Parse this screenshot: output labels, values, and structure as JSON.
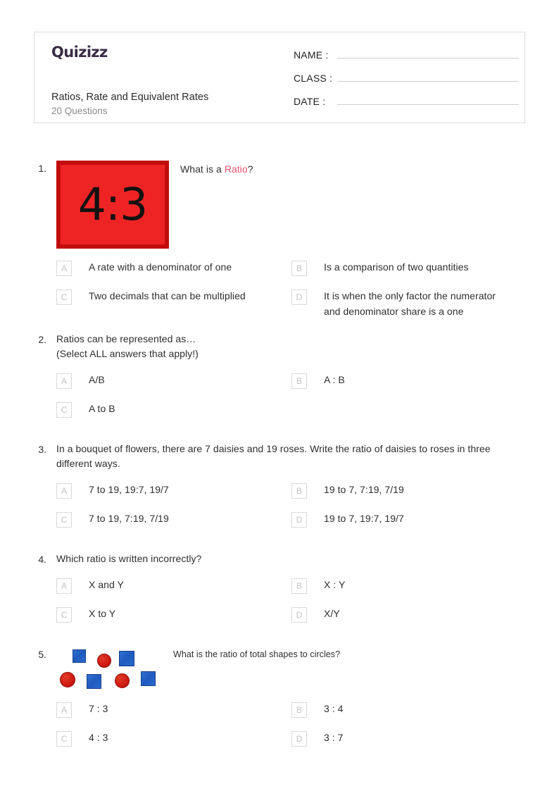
{
  "header": {
    "logo_text": "Quizizz",
    "title": "Ratios, Rate and Equivalent Rates",
    "subtitle": "20 Questions",
    "fields": [
      {
        "label": "NAME :"
      },
      {
        "label": "CLASS :"
      },
      {
        "label": "DATE  :"
      }
    ]
  },
  "questions": [
    {
      "number": "1.",
      "text_before": "What is a ",
      "highlight": "Ratio",
      "text_after": "?",
      "media": {
        "type": "ratio-card",
        "value": "4:3"
      },
      "options": [
        {
          "letter": "A",
          "text": "A rate with a denominator of one"
        },
        {
          "letter": "B",
          "text": "Is a comparison of two quantities"
        },
        {
          "letter": "C",
          "text": "Two decimals that can be multiplied"
        },
        {
          "letter": "D",
          "text": "It is when the only factor the numerator and denominator share is a one"
        }
      ]
    },
    {
      "number": "2.",
      "line1": "Ratios can be represented as…",
      "line2": "(Select ALL answers that apply!)",
      "options": [
        {
          "letter": "A",
          "text": "A/B"
        },
        {
          "letter": "B",
          "text": "A : B"
        },
        {
          "letter": "C",
          "text": "A to B"
        }
      ]
    },
    {
      "number": "3.",
      "text": "In a bouquet of flowers, there are 7 daisies and 19 roses. Write the ratio of daisies to roses in three different ways.",
      "options": [
        {
          "letter": "A",
          "text": "7 to 19, 19:7, 19/7"
        },
        {
          "letter": "B",
          "text": "19 to 7, 7:19, 7/19"
        },
        {
          "letter": "C",
          "text": "7 to 19, 7:19, 7/19"
        },
        {
          "letter": "D",
          "text": "19 to 7, 19:7, 19/7"
        }
      ]
    },
    {
      "number": "4.",
      "text": "Which ratio is written incorrectly?",
      "options": [
        {
          "letter": "A",
          "text": "X and Y"
        },
        {
          "letter": "B",
          "text": "X : Y"
        },
        {
          "letter": "C",
          "text": "X to Y"
        },
        {
          "letter": "D",
          "text": "X/Y"
        }
      ]
    },
    {
      "number": "5.",
      "text": "What is the ratio of total shapes to circles?",
      "media": {
        "type": "shapes",
        "squares": 4,
        "circles": 3
      },
      "options": [
        {
          "letter": "A",
          "text": "7 : 3"
        },
        {
          "letter": "B",
          "text": "3 : 4"
        },
        {
          "letter": "C",
          "text": "4 : 3"
        },
        {
          "letter": "D",
          "text": "3 : 7"
        }
      ]
    }
  ],
  "colors": {
    "logo": "#3a2c45",
    "highlight": "#e8566e",
    "card_fill": "#ee2424",
    "card_border": "#c20d0d",
    "square": "#2a6ad0",
    "circle": "#cf1a11"
  }
}
